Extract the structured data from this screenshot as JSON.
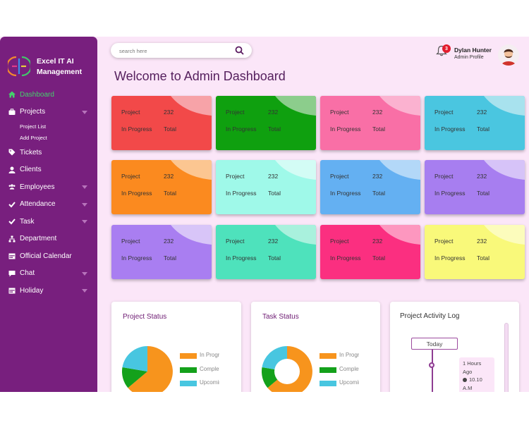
{
  "brand": {
    "name_line1": "Excel IT AI",
    "name_line2": "Management"
  },
  "sidebar": {
    "items": [
      {
        "label": "Dashboard",
        "icon": "home-icon",
        "active": true
      },
      {
        "label": "Projects",
        "icon": "briefcase-icon",
        "has_submenu": true
      },
      {
        "label": "Project List",
        "sub": true
      },
      {
        "label": "Add Project",
        "sub": true
      },
      {
        "label": "Tickets",
        "icon": "tag-icon"
      },
      {
        "label": "Clients",
        "icon": "user-icon"
      },
      {
        "label": "Employees",
        "icon": "users-icon",
        "has_submenu": true
      },
      {
        "label": "Attendance",
        "icon": "check-icon",
        "has_submenu": true
      },
      {
        "label": "Task",
        "icon": "check-icon",
        "has_submenu": true
      },
      {
        "label": "Department",
        "icon": "sitemap-icon"
      },
      {
        "label": "Official Calendar",
        "icon": "calendar-icon"
      },
      {
        "label": "Chat",
        "icon": "chat-icon",
        "has_submenu": true
      },
      {
        "label": "Holiday",
        "icon": "calendar-icon",
        "has_submenu": true
      }
    ]
  },
  "search": {
    "placeholder": "search here"
  },
  "user": {
    "name": "Dylan Hunter",
    "role": "Admin Profile",
    "notifications": "3"
  },
  "page_title": "Welcome to Admin Dashboard",
  "cards": [
    {
      "label1": "Project",
      "value1": "232",
      "label2": "In Progress",
      "value2": "Total",
      "color": "#f24949",
      "accent": "#f7a3a8"
    },
    {
      "label1": "Project",
      "value1": "232",
      "label2": "In Progress",
      "value2": "Total",
      "color": "#0fa00f",
      "accent": "#8ccd8c"
    },
    {
      "label1": "Project",
      "value1": "232",
      "label2": "In Progress",
      "value2": "Total",
      "color": "#f96fa6",
      "accent": "#fbb2d0"
    },
    {
      "label1": "Project",
      "value1": "232",
      "label2": "In Progress",
      "value2": "Total",
      "color": "#4ac6e0",
      "accent": "#a8e2ee"
    },
    {
      "label1": "Project",
      "value1": "232",
      "label2": "In Progress",
      "value2": "Total",
      "color": "#fb8a1f",
      "accent": "#fcc691"
    },
    {
      "label1": "Project",
      "value1": "232",
      "label2": "In Progress",
      "value2": "Total",
      "color": "#9ff9e9",
      "accent": "#d3fcf5"
    },
    {
      "label1": "Project",
      "value1": "232",
      "label2": "In Progress",
      "value2": "Total",
      "color": "#64b0f2",
      "accent": "#b3d8f8"
    },
    {
      "label1": "Project",
      "value1": "232",
      "label2": "In Progress",
      "value2": "Total",
      "color": "#a77ef0",
      "accent": "#d6c3f8"
    },
    {
      "label1": "Project",
      "value1": "232",
      "label2": "In Progress",
      "value2": "Total",
      "color": "#a97ef1",
      "accent": "#d8c5f8"
    },
    {
      "label1": "Project",
      "value1": "232",
      "label2": "In Progress",
      "value2": "Total",
      "color": "#4ee2bc",
      "accent": "#a9f1dd"
    },
    {
      "label1": "Project",
      "value1": "232",
      "label2": "In Progress",
      "value2": "Total",
      "color": "#fb2f80",
      "accent": "#fd97bf"
    },
    {
      "label1": "Project",
      "value1": "232",
      "label2": "In Progress",
      "value2": "Total",
      "color": "#f9f97a",
      "accent": "#fcfcbc"
    }
  ],
  "project_status": {
    "title": "Project Status",
    "legend": [
      "In Progress",
      "Completed",
      "Upcoming"
    ],
    "colors": [
      "#f7941d",
      "#14a11b",
      "#48c6e0"
    ]
  },
  "task_status": {
    "title": "Task Status",
    "legend": [
      "In Progress",
      "Completed",
      "Upcoming"
    ],
    "colors": [
      "#f7941d",
      "#14a11b",
      "#48c6e0"
    ]
  },
  "activity_log": {
    "title": "Project Activity Log",
    "today": "Today",
    "entry_ago": "1 Hours Ago",
    "entry_time": "10.10 A.M"
  }
}
